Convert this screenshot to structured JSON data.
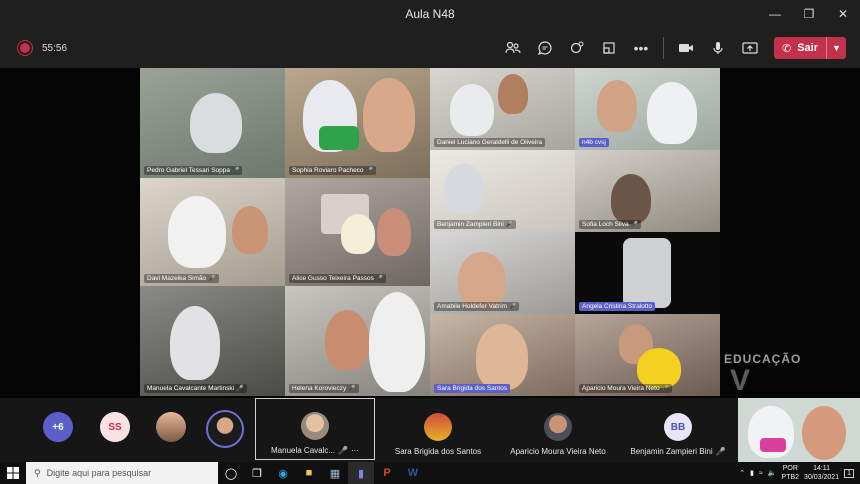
{
  "window": {
    "title": "Aula N48"
  },
  "meeting": {
    "elapsed": "55:56",
    "leave_label": "Sair"
  },
  "grid_tiles": [
    {
      "name": "Pedro Gabriel Tessari Soppa"
    },
    {
      "name": "Sophia Roviaro Pacheco"
    },
    {
      "name": "Daniel Luciano Geraldelli de Oliveira"
    },
    {
      "name": "n4b cvsj"
    },
    {
      "name": "Davi Mazeika Simão"
    },
    {
      "name": "Alice Gusso Teixeira Passos"
    },
    {
      "name": "Benjamin Zampieri Bini"
    },
    {
      "name": "Sofia Loch Silva"
    },
    {
      "name": "Amabile Holdefer Vatrim"
    },
    {
      "name": "Angela Cristina Stralotto"
    },
    {
      "name": "Manuela Cavalcante Martinski"
    },
    {
      "name": "Helena Korovieczy"
    },
    {
      "name": "Sara Brigida dos Santos"
    },
    {
      "name": "Aparicio Moura Vieira Neto"
    }
  ],
  "watermark": {
    "text": "EDUCAÇÃO"
  },
  "strip": {
    "overflow_count": "+6",
    "initials_1": "SS",
    "participants": [
      {
        "name": "Manuela Cavalc..."
      },
      {
        "name": "Sara Brigida dos Santos"
      },
      {
        "name": "Aparicio Moura Vieira Neto"
      },
      {
        "name": "Benjamin Zampieri Bini",
        "initials": "BB"
      }
    ],
    "more_label": "···"
  },
  "taskbar": {
    "search_placeholder": "Digite aqui para pesquisar",
    "lang": "POR",
    "layout": "PTB2",
    "time": "14:11",
    "date": "30/03/2021",
    "notif_count": "1"
  },
  "colors": {
    "accent": "#5b5fc7",
    "leave": "#c4314b"
  }
}
